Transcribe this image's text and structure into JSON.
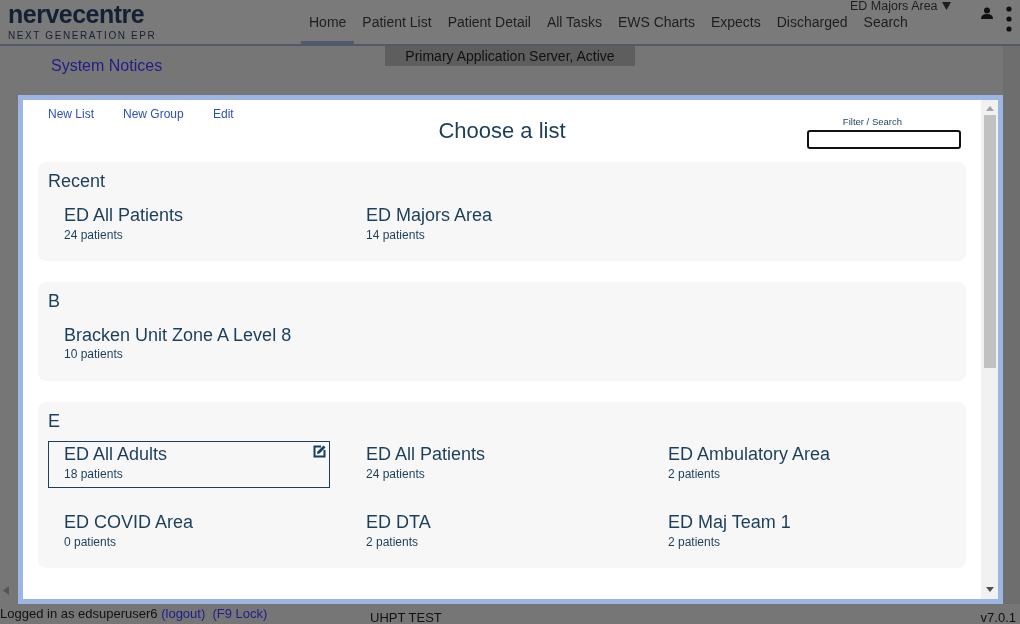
{
  "header": {
    "logo": {
      "name": "nervecentre",
      "tagline": "NEXT GENERATION EPR"
    },
    "nav": [
      {
        "label": "Home",
        "selected": true
      },
      {
        "label": "Patient List",
        "selected": false
      },
      {
        "label": "Patient Detail",
        "selected": false
      },
      {
        "label": "All Tasks",
        "selected": false
      },
      {
        "label": "EWS Charts",
        "selected": false
      },
      {
        "label": "Expects",
        "selected": false
      },
      {
        "label": "Discharged",
        "selected": false
      },
      {
        "label": "Search",
        "selected": false
      }
    ],
    "ward_selector": "ED Majors Area"
  },
  "server_status": "Primary Application Server, Active",
  "system_notices": "System Notices",
  "modal": {
    "actions": [
      "New List",
      "New Group",
      "Edit"
    ],
    "title": "Choose a list",
    "filter": {
      "label": "Filter / Search"
    },
    "sections": [
      {
        "heading": "Recent",
        "lists": [
          {
            "name": "ED All Patients",
            "count": "24 patients",
            "selected": false
          },
          {
            "name": "ED Majors Area",
            "count": "14 patients",
            "selected": false
          }
        ]
      },
      {
        "heading": "B",
        "lists": [
          {
            "name": "Bracken Unit Zone A Level 8",
            "count": "10 patients",
            "selected": false
          }
        ]
      },
      {
        "heading": "E",
        "lists": [
          {
            "name": "ED All Adults",
            "count": "18 patients",
            "selected": true
          },
          {
            "name": "ED All Patients",
            "count": "24 patients",
            "selected": false
          },
          {
            "name": "ED Ambulatory Area",
            "count": "2 patients",
            "selected": false
          },
          {
            "name": "ED COVID Area",
            "count": "0 patients",
            "selected": false
          },
          {
            "name": "ED DTA",
            "count": "2 patients",
            "selected": false
          },
          {
            "name": "ED Maj Team 1",
            "count": "2 patients",
            "selected": false
          }
        ]
      }
    ]
  },
  "footer": {
    "login": "Logged in as edsuperuser6",
    "logout": "(logout)",
    "lock": "(F9 Lock)",
    "environment": "UHPT TEST",
    "version": "v7.0.1"
  }
}
